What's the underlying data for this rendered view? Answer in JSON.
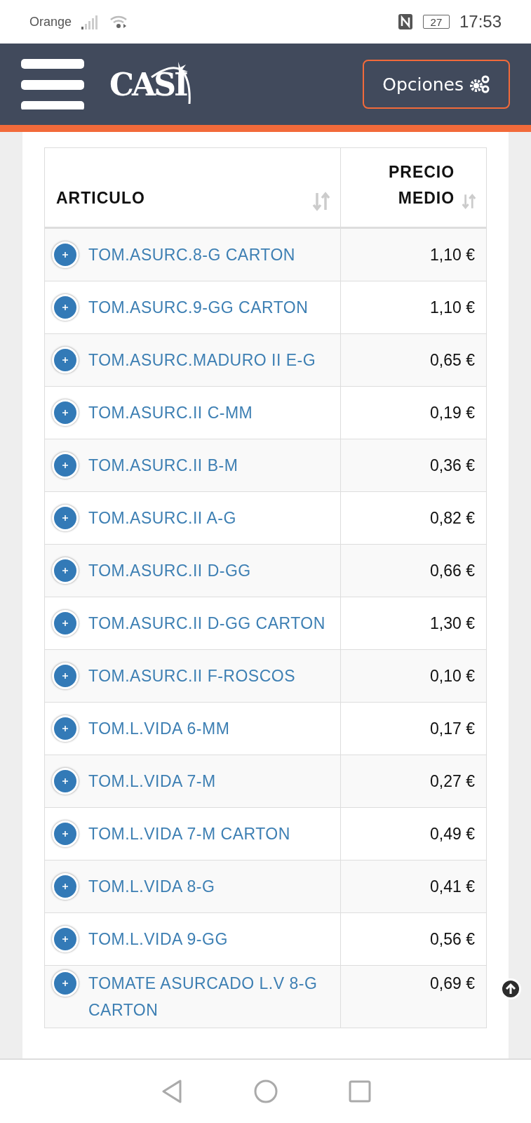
{
  "status_bar": {
    "carrier": "Orange",
    "battery": "27",
    "time": "17:53"
  },
  "header": {
    "logo": "CASI",
    "options_button": "Opciones"
  },
  "table": {
    "columns": [
      "ARTICULO",
      "PRECIO MEDIO"
    ],
    "rows": [
      {
        "article": "TOM.ASURC.8-G CARTON",
        "price": "1,10 €"
      },
      {
        "article": "TOM.ASURC.9-GG CARTON",
        "price": "1,10 €"
      },
      {
        "article": "TOM.ASURC.MADURO II E-G",
        "price": "0,65 €"
      },
      {
        "article": "TOM.ASURC.II C-MM",
        "price": "0,19 €"
      },
      {
        "article": "TOM.ASURC.II B-M",
        "price": "0,36 €"
      },
      {
        "article": "TOM.ASURC.II A-G",
        "price": "0,82 €"
      },
      {
        "article": "TOM.ASURC.II D-GG",
        "price": "0,66 €"
      },
      {
        "article": "TOM.ASURC.II D-GG CARTON",
        "price": "1,30 €"
      },
      {
        "article": "TOM.ASURC.II F-ROSCOS",
        "price": "0,10 €"
      },
      {
        "article": "TOM.L.VIDA 6-MM",
        "price": "0,17 €"
      },
      {
        "article": "TOM.L.VIDA 7-M",
        "price": "0,27 €"
      },
      {
        "article": "TOM.L.VIDA 7-M CARTON",
        "price": "0,49 €"
      },
      {
        "article": "TOM.L.VIDA 8-G",
        "price": "0,41 €"
      },
      {
        "article": "TOM.L.VIDA 9-GG",
        "price": "0,56 €"
      },
      {
        "article": "TOMATE ASURCADO L.V 8-G CARTON",
        "price": "0,69 €"
      }
    ]
  }
}
